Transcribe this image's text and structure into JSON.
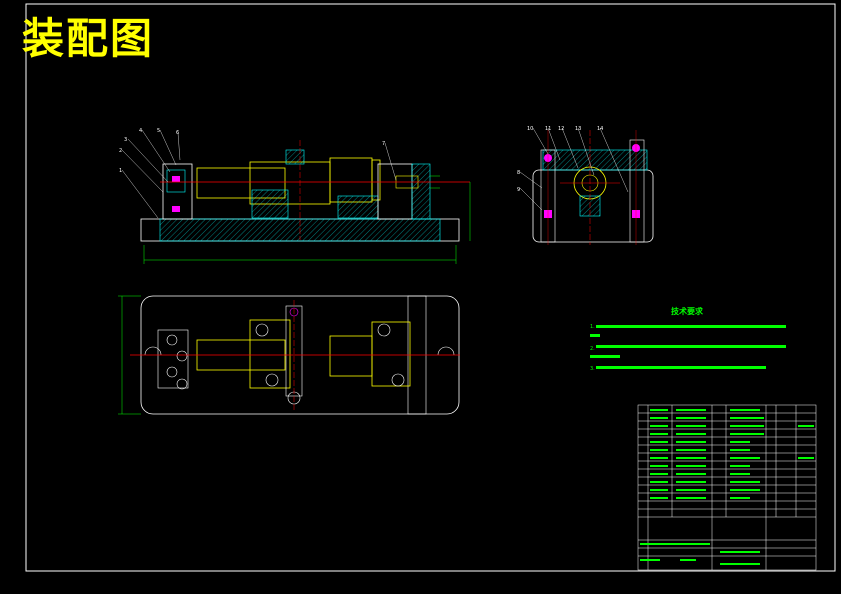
{
  "drawing": {
    "title": "装配图",
    "tech_requirements_title": "技术要求",
    "tech_requirements": [
      "1.",
      "2.",
      "3."
    ],
    "callouts_front": [
      "1",
      "2",
      "3",
      "4",
      "5",
      "6",
      "7"
    ],
    "callouts_side": [
      "8",
      "9",
      "10",
      "11",
      "12",
      "13",
      "14"
    ],
    "colors": {
      "background": "#000000",
      "outline": "#ffffff",
      "part": "#00ffff",
      "shaft": "#ffff00",
      "centerline": "#ff0000",
      "dimension": "#00ff00",
      "accent": "#ff00ff"
    }
  }
}
